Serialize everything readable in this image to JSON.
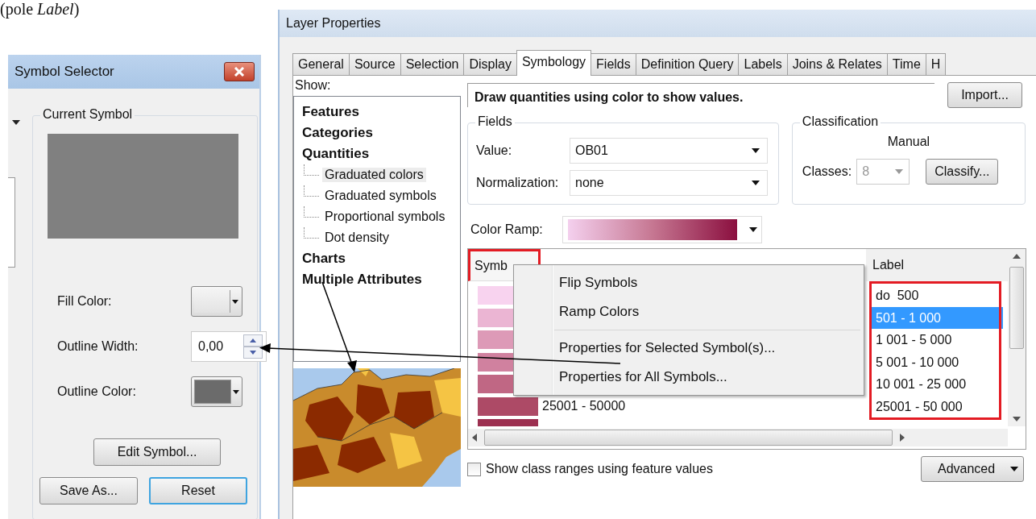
{
  "caption": "(pole *Label*)",
  "symbol_selector": {
    "title": "Symbol Selector",
    "group_title": "Current Symbol",
    "fill_color": {
      "label": "Fill Color:"
    },
    "outline_width": {
      "label": "Outline Width:",
      "value": "0,00"
    },
    "outline_color": {
      "label": "Outline Color:"
    },
    "edit_button": {
      "label": "Edit Symbol...",
      "focused": false
    },
    "buttons": [
      {
        "label": "Save As...",
        "focused": false
      },
      {
        "label": "Reset",
        "focused": true
      }
    ]
  },
  "layer_properties": {
    "title": "Layer Properties",
    "tabs": [
      {
        "label": "General",
        "selected": false
      },
      {
        "label": "Source",
        "selected": false
      },
      {
        "label": "Selection",
        "selected": false
      },
      {
        "label": "Display",
        "selected": false
      },
      {
        "label": "Symbology",
        "selected": true
      },
      {
        "label": "Fields",
        "selected": false
      },
      {
        "label": "Definition Query",
        "selected": false
      },
      {
        "label": "Labels",
        "selected": false
      },
      {
        "label": "Joins & Relates",
        "selected": false
      },
      {
        "label": "Time",
        "selected": false
      },
      {
        "label": "H",
        "selected": false
      }
    ],
    "show_label": "Show:",
    "tree": [
      {
        "label": "Features",
        "selected": false
      },
      {
        "label": "Categories",
        "selected": false
      },
      {
        "label": "Quantities",
        "selected": false,
        "children": [
          {
            "label": "Graduated colors",
            "selected": true
          },
          {
            "label": "Graduated symbols",
            "selected": false
          },
          {
            "label": "Proportional symbols",
            "selected": false
          },
          {
            "label": "Dot density",
            "selected": false
          }
        ]
      },
      {
        "label": "Charts",
        "selected": false
      },
      {
        "label": "Multiple Attributes",
        "selected": false
      }
    ],
    "description": "Draw quantities using color to show values.",
    "import_button": "Import...",
    "fields": {
      "title": "Fields",
      "value": {
        "label": "Value:",
        "value": "OB01"
      },
      "normalization": {
        "label": "Normalization:",
        "value": "none"
      }
    },
    "classification": {
      "title": "Classification",
      "method": "Manual",
      "classes": {
        "label": "Classes:",
        "value": "8",
        "disabled": true
      },
      "button": "Classify..."
    },
    "color_ramp": {
      "label": "Color Ramp:"
    },
    "table": {
      "columns": [
        "Symb",
        "Label"
      ],
      "rows": [
        {
          "color": "#f8d3ef",
          "label": "do  500",
          "selected": false
        },
        {
          "color": "#ebb5d3",
          "label": "501 - 1 000",
          "selected": true
        },
        {
          "color": "#dd9ab7",
          "label": "1 001 - 5 000",
          "selected": false
        },
        {
          "color": "#d0819f",
          "label": "5 001 - 10 000",
          "selected": false
        },
        {
          "color": "#c06784",
          "label": "10 001 - 25 000",
          "selected": false
        },
        {
          "color": "#ad4a66",
          "range": "25001 - 50000",
          "label": "25001 - 50 000",
          "selected": false
        },
        {
          "color": "#9c2f50",
          "selected": false
        }
      ]
    },
    "context_menu": [
      {
        "items": [
          "Flip Symbols",
          "Ramp Colors"
        ]
      },
      {
        "items": [
          "Properties for Selected Symbol(s)...",
          "Properties for All Symbols..."
        ]
      }
    ],
    "checkbox": {
      "label": "Show class ranges using feature values",
      "checked": false
    },
    "advanced_button": "Advanced"
  }
}
